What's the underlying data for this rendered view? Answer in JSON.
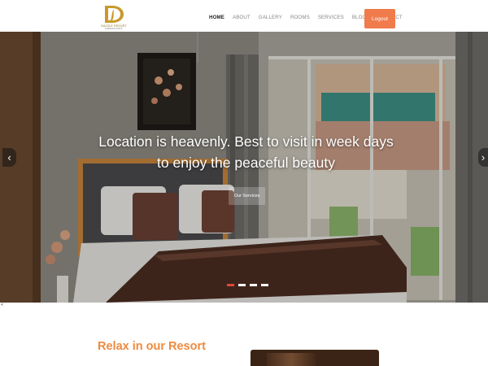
{
  "header": {
    "logo_name": "DAZZLE RESORT",
    "logo_tagline": "DAZZLING STAYS",
    "nav": [
      {
        "label": "HOME",
        "active": true
      },
      {
        "label": "ABOUT",
        "active": false
      },
      {
        "label": "GALLERY",
        "active": false
      },
      {
        "label": "ROOMS",
        "active": false
      },
      {
        "label": "SERVICES",
        "active": false
      },
      {
        "label": "BLOGS",
        "active": false
      },
      {
        "label": "CONTACT",
        "active": false
      }
    ],
    "logout_label": "Logout"
  },
  "hero": {
    "headline_line1": "Location is heavenly. Best to visit in week days",
    "headline_line2": "to enjoy the peaceful beauty",
    "cta_label": "Our Services",
    "prev_icon": "chevron-left-icon",
    "next_icon": "chevron-right-icon",
    "slides_total": 4,
    "active_slide": 1
  },
  "stray_char": "<",
  "section": {
    "title": "Relax in our Resort"
  },
  "colors": {
    "accent": "#f07b4b",
    "title": "#ef8a3e",
    "active_dot": "#e0463a"
  }
}
